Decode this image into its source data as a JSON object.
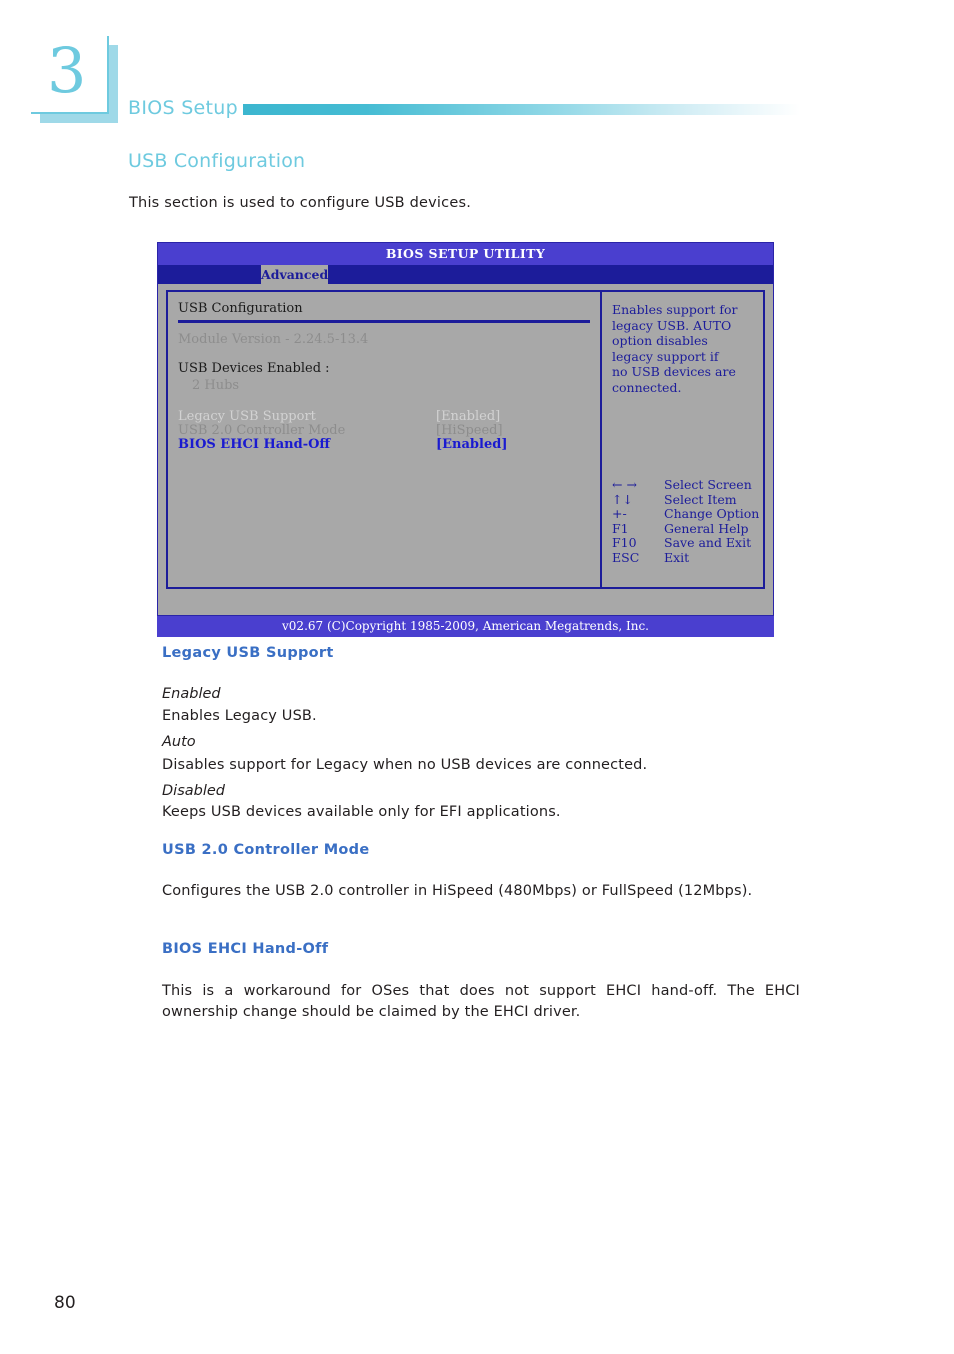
{
  "chapter": {
    "number": "3",
    "title": "BIOS Setup"
  },
  "page": {
    "section_title": "USB Configuration",
    "intro": "This section is used to configure USB devices.",
    "page_number": "80"
  },
  "bios": {
    "title": "BIOS SETUP UTILITY",
    "active_tab": "Advanced",
    "left_panel": {
      "heading": "USB Configuration",
      "module_version": "Module Version - 2.24.5-13.4",
      "devices_enabled_label": "USB Devices Enabled :",
      "devices_enabled_value": "2 Hubs",
      "options": [
        {
          "label": "Legacy USB Support",
          "value": "[Enabled]",
          "state": "disabled"
        },
        {
          "label": "USB 2.0 Controller Mode",
          "value": "[HiSpeed]",
          "state": "dim"
        },
        {
          "label": "BIOS EHCI Hand-Off",
          "value": "[Enabled]",
          "state": "active"
        }
      ]
    },
    "help": {
      "line1": "Enables support for",
      "line2": "legacy USB. AUTO",
      "line3": "option disables",
      "line4": "legacy support if",
      "line5": "no USB devices are",
      "line6": "connected."
    },
    "keys": [
      {
        "key": "← →",
        "desc": "Select Screen"
      },
      {
        "key": "↑↓",
        "desc": "Select Item"
      },
      {
        "key": "+-",
        "desc": "Change Option"
      },
      {
        "key": "F1",
        "desc": "General Help"
      },
      {
        "key": "F10",
        "desc": "Save and Exit"
      },
      {
        "key": "ESC",
        "desc": "Exit"
      }
    ],
    "footer": "v02.67 (C)Copyright 1985-2009, American Megatrends, Inc."
  },
  "sections": {
    "legacy_usb": {
      "heading": "Legacy USB Support",
      "items": [
        {
          "term": "Enabled",
          "desc": "Enables Legacy USB."
        },
        {
          "term": "Auto",
          "desc": "Disables support for Legacy when no USB devices are connected."
        },
        {
          "term": "Disabled",
          "desc": "Keeps USB devices available only for EFI applications."
        }
      ]
    },
    "usb20_mode": {
      "heading": "USB 2.0 Controller Mode",
      "body": "Configures the USB 2.0 controller in HiSpeed (480Mbps) or FullSpeed (12Mbps)."
    },
    "ehci_handoff": {
      "heading": "BIOS EHCI Hand-Off",
      "body": "This is a workaround for OSes that does not support EHCI hand-off. The EHCI ownership change should be claimed by the EHCI driver."
    }
  },
  "colors": {
    "accent_teal": "#6ecadf",
    "heading_blue": "#3a6fc4",
    "bios_titlebar": "#4a3fcf",
    "bios_tabbar": "#1c1c9a",
    "bios_bg": "#a8a8a8"
  }
}
